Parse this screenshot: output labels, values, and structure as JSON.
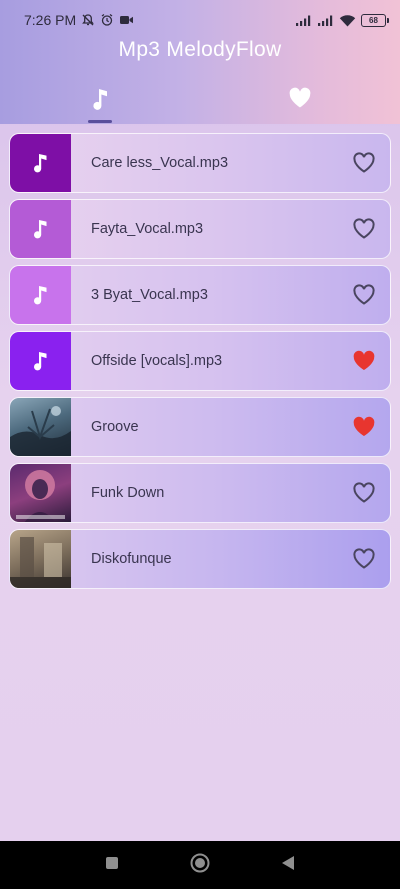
{
  "status_bar": {
    "time": "7:26 PM",
    "battery": "68"
  },
  "app": {
    "title": "Mp3 MelodyFlow"
  },
  "tabs": [
    {
      "icon": "music-note-icon",
      "selected": true
    },
    {
      "icon": "heart-icon",
      "selected": false
    }
  ],
  "songs": [
    {
      "title": "Care less_Vocal.mp3",
      "thumb": "music-note-icon",
      "thumb_color": "#7e0fa6",
      "favorite": false
    },
    {
      "title": "Fayta_Vocal.mp3",
      "thumb": "music-note-icon",
      "thumb_color": "#b45bd6",
      "favorite": false
    },
    {
      "title": "3 Byat_Vocal.mp3",
      "thumb": "music-note-icon",
      "thumb_color": "#c873ec",
      "favorite": false
    },
    {
      "title": "Offside [vocals].mp3",
      "thumb": "music-note-icon",
      "thumb_color": "#8a21ef",
      "favorite": true
    },
    {
      "title": "Groove",
      "thumb": "album-art-image",
      "favorite": true
    },
    {
      "title": "Funk Down",
      "thumb": "album-art-image",
      "favorite": false
    },
    {
      "title": "Diskofunque",
      "thumb": "album-art-image",
      "favorite": false
    }
  ],
  "colors": {
    "favorite_active": "#e8352f",
    "favorite_inactive": "#4a4560",
    "tab_indicator": "#5a4f9c"
  }
}
